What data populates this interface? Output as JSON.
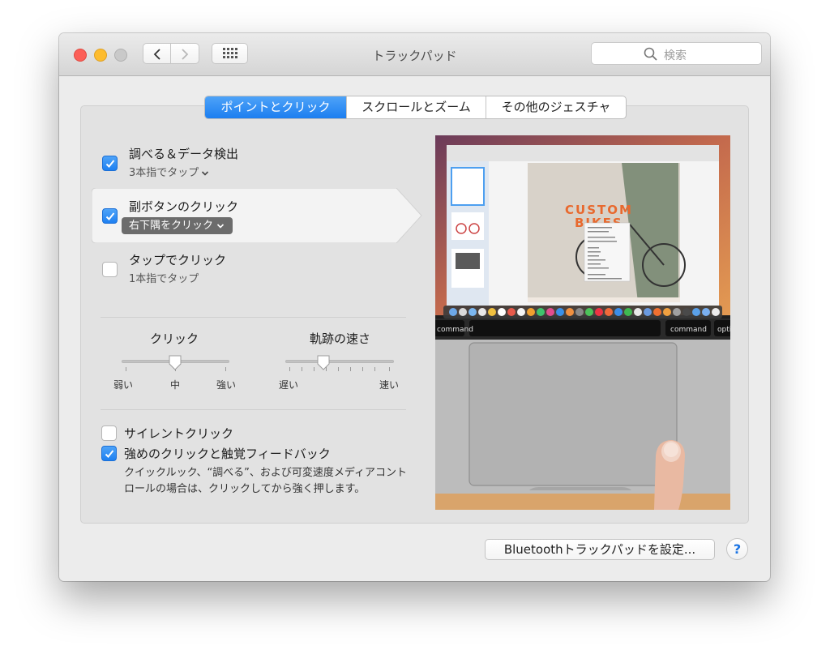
{
  "window": {
    "title": "トラックパッド"
  },
  "search": {
    "placeholder": "検索"
  },
  "tabs": [
    {
      "label": "ポイントとクリック",
      "active": true
    },
    {
      "label": "スクロールとズーム",
      "active": false
    },
    {
      "label": "その他のジェスチャ",
      "active": false
    }
  ],
  "options": [
    {
      "label": "調べる＆データ検出",
      "sub": "3本指でタップ",
      "checked": true
    },
    {
      "label": "副ボタンのクリック",
      "sub": "右下隅をクリック",
      "checked": true
    },
    {
      "label": "タップでクリック",
      "sub": "1本指でタップ",
      "checked": false
    }
  ],
  "sliders": {
    "click": {
      "title": "クリック",
      "min_label": "弱い",
      "mid_label": "中",
      "max_label": "強い",
      "value": 0.5
    },
    "tracking": {
      "title": "軌跡の速さ",
      "min_label": "遅い",
      "max_label": "速い",
      "value": 0.35
    }
  },
  "bottom_options": [
    {
      "label": "サイレントクリック",
      "checked": false
    },
    {
      "label": "強めのクリックと触覚フィードバック",
      "checked": true
    }
  ],
  "description": "クイックルック、“調べる”、および可変速度メディアコントロールの場合は、クリックしてから強く押します。",
  "preview": {
    "title_line1": "CUSTOM",
    "title_line2": "BIKES",
    "key_left": "command",
    "key_right": "command",
    "key_far_right": "opti"
  },
  "footer": {
    "bluetooth_button": "Bluetoothトラックパッドを設定...",
    "help": "?"
  },
  "colors": {
    "accent": "#1c7ef0",
    "close": "#fc5f57",
    "minimize": "#fdbc2e",
    "zoom": "#c9c9c9"
  }
}
